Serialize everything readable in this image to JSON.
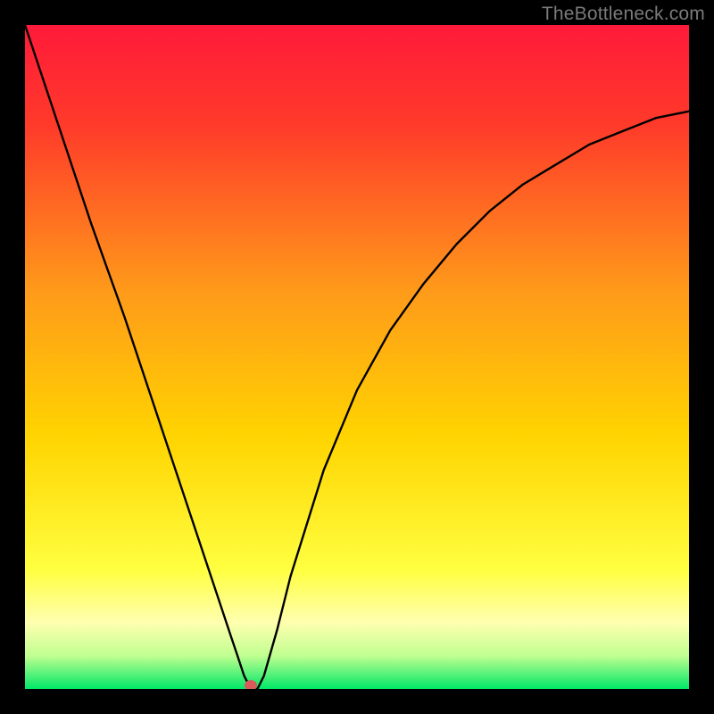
{
  "watermark": "TheBottleneck.com",
  "colors": {
    "frame": "#000000",
    "gradient_top": "#ff1a3a",
    "gradient_mid": "#ffd400",
    "gradient_pale": "#ffff99",
    "gradient_bottom": "#00e868",
    "curve": "#000000",
    "marker": "#d85a5a"
  },
  "chart_data": {
    "type": "line",
    "title": "",
    "xlabel": "",
    "ylabel": "",
    "xlim": [
      0,
      100
    ],
    "ylim": [
      0,
      100
    ],
    "annotations": [
      {
        "kind": "marker",
        "x": 34,
        "y": 0,
        "color": "#d85a5a"
      }
    ],
    "series": [
      {
        "name": "curve",
        "x": [
          0,
          5,
          10,
          15,
          20,
          25,
          28,
          30,
          31,
          32,
          33,
          34,
          35,
          36,
          38,
          40,
          45,
          50,
          55,
          60,
          65,
          70,
          75,
          80,
          85,
          90,
          95,
          100
        ],
        "y": [
          100,
          85,
          70,
          56,
          41,
          26,
          17,
          11,
          8,
          5,
          2,
          0,
          0,
          2,
          9,
          17,
          33,
          45,
          54,
          61,
          67,
          72,
          76,
          79,
          82,
          84,
          86,
          87
        ]
      }
    ]
  }
}
